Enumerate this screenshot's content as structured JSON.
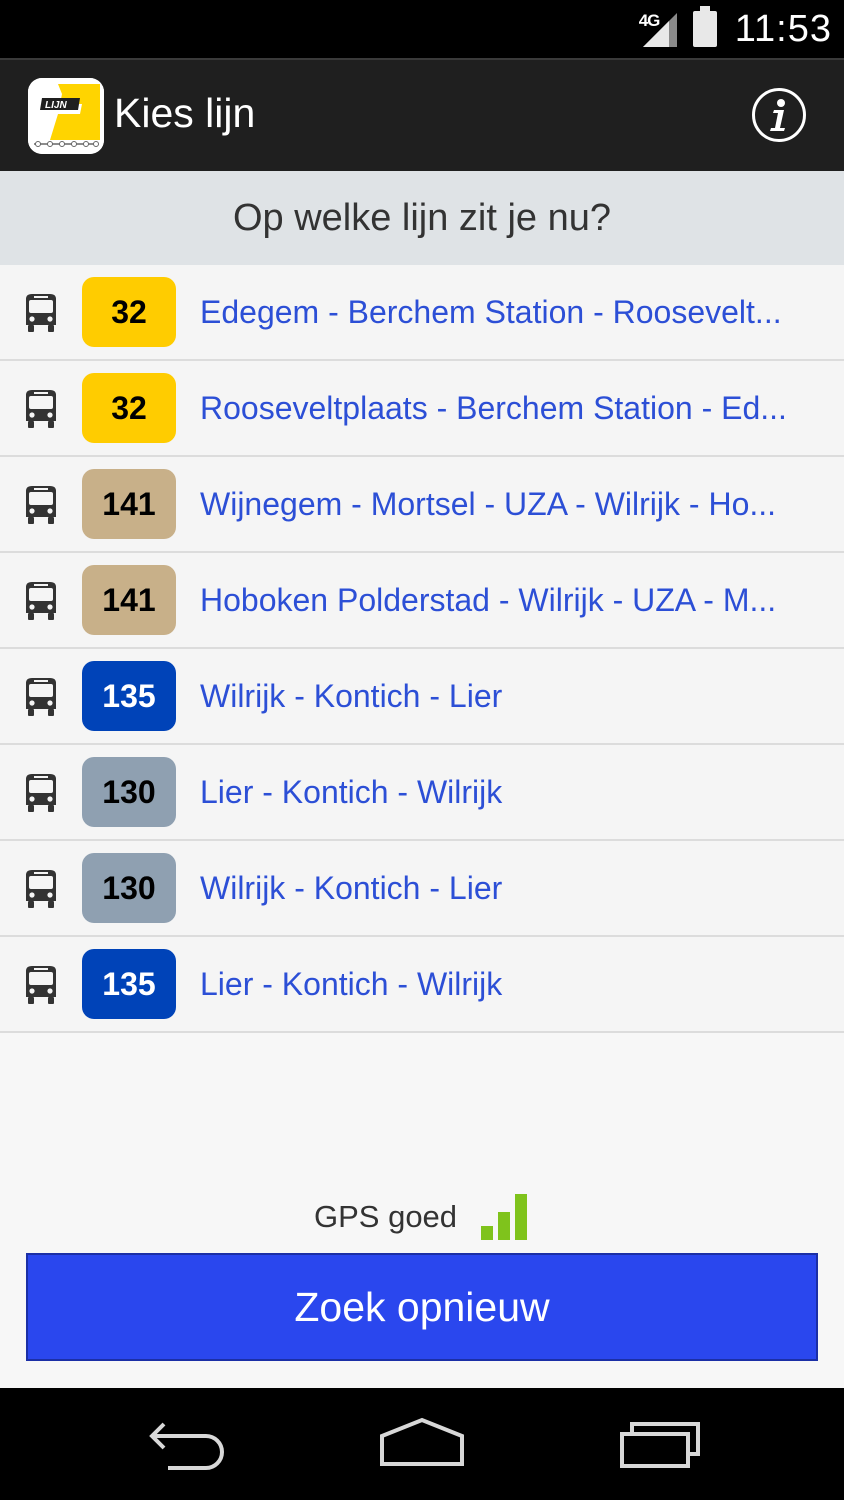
{
  "status_bar": {
    "network": "4G",
    "time": "11:53"
  },
  "action_bar": {
    "title": "Kies lijn"
  },
  "question": "Op welke lijn zit je nu?",
  "lines": [
    {
      "number": "32",
      "destination": "Edegem - Berchem Station - Roosevelt...",
      "badge_color": "#FFCC00",
      "text_color": "#000000"
    },
    {
      "number": "32",
      "destination": "Rooseveltplaats - Berchem Station - Ed...",
      "badge_color": "#FFCC00",
      "text_color": "#000000"
    },
    {
      "number": "141",
      "destination": "Wijnegem - Mortsel - UZA - Wilrijk - Ho...",
      "badge_color": "#C8B089",
      "text_color": "#000000"
    },
    {
      "number": "141",
      "destination": "Hoboken Polderstad - Wilrijk - UZA - M...",
      "badge_color": "#C8B089",
      "text_color": "#000000"
    },
    {
      "number": "135",
      "destination": "Wilrijk - Kontich - Lier",
      "badge_color": "#0043B8",
      "text_color": "#FFFFFF"
    },
    {
      "number": "130",
      "destination": "Lier - Kontich - Wilrijk",
      "badge_color": "#8FA0B1",
      "text_color": "#000000"
    },
    {
      "number": "130",
      "destination": "Wilrijk - Kontich - Lier",
      "badge_color": "#8FA0B1",
      "text_color": "#000000"
    },
    {
      "number": "135",
      "destination": "Lier - Kontich - Wilrijk",
      "badge_color": "#0043B8",
      "text_color": "#FFFFFF"
    }
  ],
  "gps": {
    "label": "GPS goed",
    "signal_color": "#7FC31C"
  },
  "search_button": {
    "label": "Zoek opnieuw"
  },
  "colors": {
    "link_text": "#2C4FD6",
    "button_bg": "#2A47EE"
  }
}
